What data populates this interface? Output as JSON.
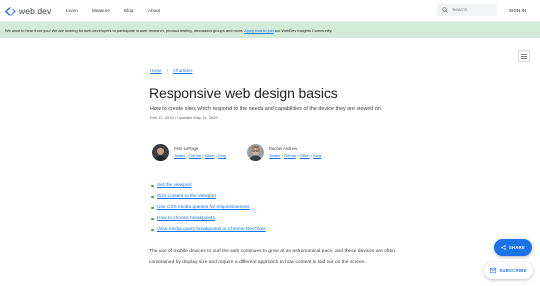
{
  "header": {
    "logo_text": "web.dev",
    "nav": [
      {
        "label": "Learn"
      },
      {
        "label": "Measure"
      },
      {
        "label": "Blog"
      },
      {
        "label": "About"
      }
    ],
    "search_placeholder": "Search",
    "signin_label": "SIGN IN"
  },
  "banner": {
    "text_before": "We want to hear from you! We are looking for web developers to participate in user research, product testing, discussion groups and more. ",
    "link_text": "Apply now to join",
    "text_after": " our WebDev Insights Community."
  },
  "breadcrumb": {
    "home": "Home",
    "all_articles": "All articles"
  },
  "article": {
    "title": "Responsive web design basics",
    "subtitle": "How to create sites which respond to the needs and capabilities of the device they are viewed on.",
    "dates": "Feb 12, 2019 • Updated May 14, 2020",
    "authors": [
      {
        "name": "Pete LePage",
        "links": [
          "Twitter",
          "GitHub",
          "Glitch",
          "Blog"
        ]
      },
      {
        "name": "Rachel Andrew",
        "links": [
          "Twitter",
          "GitHub",
          "Glitch",
          "Blog"
        ]
      }
    ],
    "toc": [
      "Set the viewport",
      "Size content to the viewport",
      "Use CSS media queries for responsiveness",
      "How to choose breakpoints",
      "View media query breakpoints in Chrome DevTools"
    ],
    "body": "The use of mobile devices to surf the web continues to grow at an astronomical pace, and these devices are often constrained by display size and require a different approach to how content is laid out on the screen."
  },
  "fab": {
    "share_label": "SHARE",
    "subscribe_label": "SUBSCRIBE"
  },
  "colors": {
    "accent": "#1a73e8",
    "banner_bg": "#d2ebd8",
    "bullet": "#34a853"
  }
}
